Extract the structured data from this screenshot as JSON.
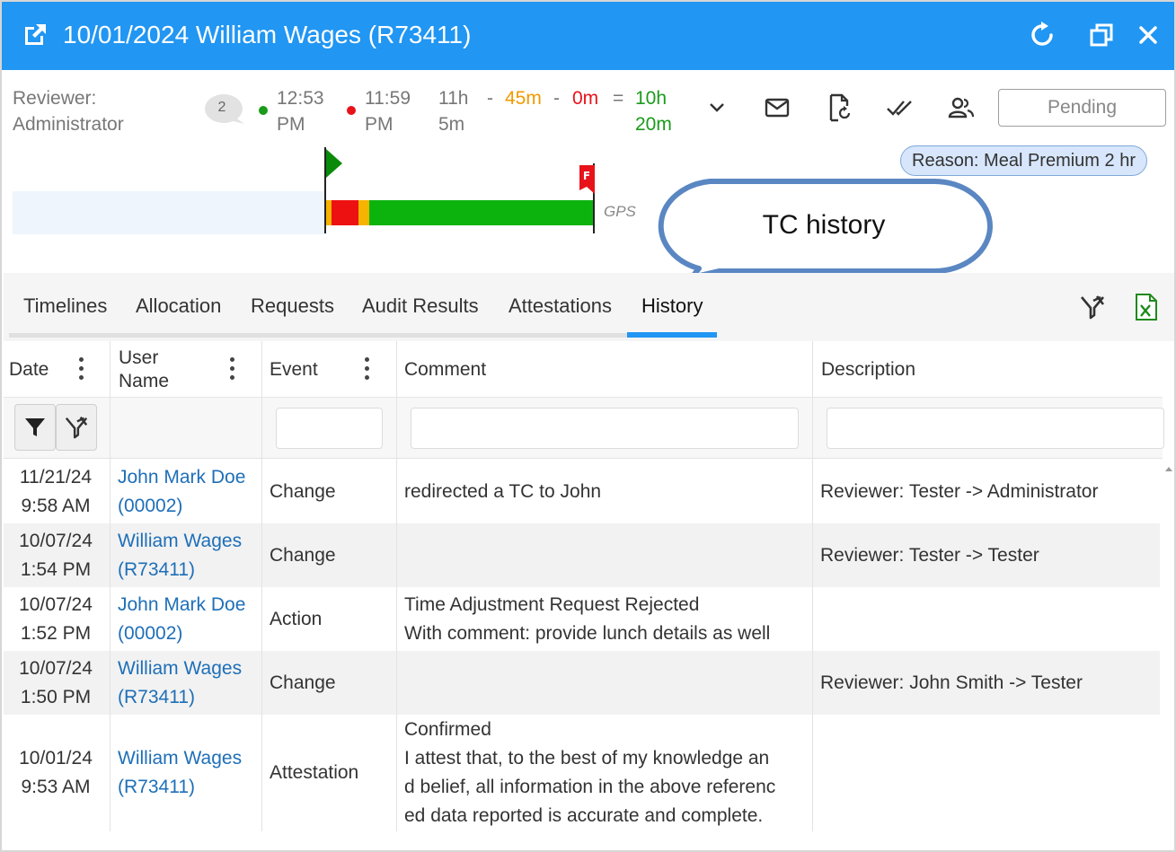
{
  "window": {
    "title": "10/01/2024 William Wages (R73411)"
  },
  "header": {
    "reviewer_label": "Reviewer:",
    "reviewer_name": "Administrator",
    "comment_count": "2",
    "start_time_1": "12:53",
    "start_time_2": "PM",
    "end_time_1": "11:59",
    "end_time_2": "PM",
    "total_1": "11h",
    "total_2": "5m",
    "minus1": "-",
    "break": "45m",
    "minus2": "-",
    "zero": "0m",
    "equals": "=",
    "result_1": "10h",
    "result_2": "20m",
    "status_button": "Pending",
    "reason": "Reason: Meal Premium 2 hr"
  },
  "timeline": {
    "gps_label": "GPS",
    "flag_letter": "F"
  },
  "callout": {
    "text": "TC history"
  },
  "tabs": [
    {
      "label": "Timelines"
    },
    {
      "label": "Allocation"
    },
    {
      "label": "Requests"
    },
    {
      "label": "Audit Results"
    },
    {
      "label": "Attestations"
    },
    {
      "label": "History"
    }
  ],
  "grid": {
    "columns": {
      "date": "Date",
      "user_1": "User",
      "user_2": "Name",
      "event": "Event",
      "comment": "Comment",
      "description": "Description"
    },
    "rows": [
      {
        "date_1": "11/21/24",
        "date_2": "9:58 AM",
        "user_1": "John Mark Doe",
        "user_2": "(00002)",
        "event": "Change",
        "comment_lines": [
          "redirected a TC to John"
        ],
        "description": "Reviewer: Tester -> Administrator"
      },
      {
        "date_1": "10/07/24",
        "date_2": "1:54 PM",
        "user_1": "William Wages",
        "user_2": "(R73411)",
        "event": "Change",
        "comment_lines": [],
        "description": "Reviewer: Tester -> Tester"
      },
      {
        "date_1": "10/07/24",
        "date_2": "1:52 PM",
        "user_1": "John Mark Doe",
        "user_2": "(00002)",
        "event": "Action",
        "comment_lines": [
          "Time Adjustment Request Rejected",
          "With comment: provide lunch details as well"
        ],
        "description": ""
      },
      {
        "date_1": "10/07/24",
        "date_2": "1:50 PM",
        "user_1": "William Wages",
        "user_2": "(R73411)",
        "event": "Change",
        "comment_lines": [],
        "description": "Reviewer: John Smith -> Tester"
      },
      {
        "date_1": "10/01/24",
        "date_2": "9:53 AM",
        "user_1": "William Wages",
        "user_2": "(R73411)",
        "event": "Attestation",
        "comment_lines": [
          "Confirmed",
          "I attest that, to the best of my knowledge an",
          "d belief, all information in the above referenc",
          "ed data reported is accurate and complete."
        ],
        "description": ""
      }
    ]
  },
  "colors": {
    "titlebar": "#2196f3",
    "link": "#1e6fb8",
    "timeline_green": "#0db30d",
    "timeline_red": "#ee1111",
    "timeline_orange": "#f5b400"
  }
}
